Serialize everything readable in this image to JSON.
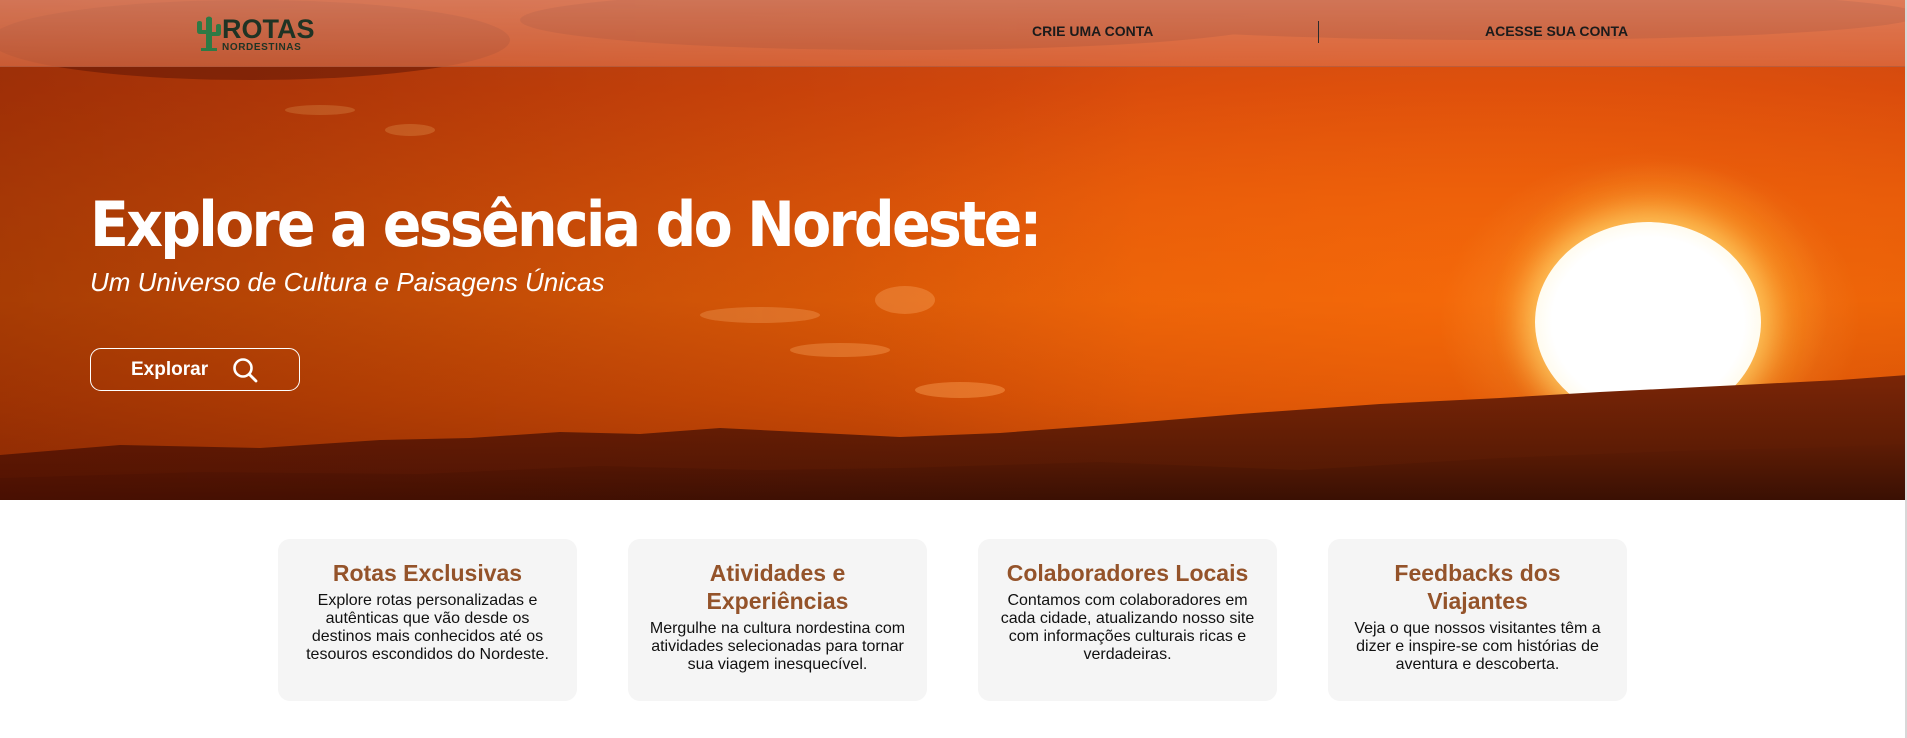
{
  "brand": {
    "name": "ROTAS",
    "tagline": "NORDESTINAS",
    "color": "#1f3324",
    "icon": "cactus-icon"
  },
  "nav": {
    "create_account": "CRIE UMA CONTA",
    "login": "ACESSE SUA CONTA"
  },
  "hero": {
    "title": "Explore a essência do Nordeste:",
    "subtitle": "Um Universo de Cultura e Paisagens Únicas",
    "button_label": "Explorar",
    "button_icon": "search-icon",
    "background": "sunset-over-mountains"
  },
  "features": [
    {
      "title": "Rotas Exclusivas",
      "text": "Explore rotas personalizadas e autênticas que vão desde os destinos mais conhecidos até os tesouros escondidos do Nordeste."
    },
    {
      "title": "Atividades e Experiências",
      "text": "Mergulhe na cultura nordestina com atividades selecionadas para tornar sua viagem inesquecível."
    },
    {
      "title": "Colaboradores Locais",
      "text": "Contamos com colaboradores em cada cidade, atualizando nosso site com informações culturais ricas e verdadeiras."
    },
    {
      "title": "Feedbacks dos Viajantes",
      "text": "Veja o que nossos visitantes têm a dizer e inspire-se com histórias de aventura e descoberta."
    }
  ],
  "colors": {
    "accent": "#94532a",
    "card_bg": "#f5f5f5",
    "hero_orange": "#e4590a"
  }
}
